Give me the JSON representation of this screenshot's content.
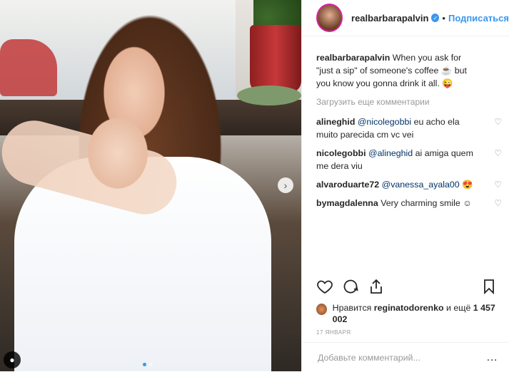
{
  "post": {
    "author": "realbarbarapalvin",
    "verified_icon": "verified-badge-icon",
    "separator": "•",
    "follow_label": "Подписаться",
    "caption": {
      "user": "realbarbarapalvin",
      "text": " When you ask for \"just a sip\" of someone's coffee ☕ but you know you gonna drink it all. 😜"
    },
    "load_more_label": "Загрузить еще комментарии",
    "comments": [
      {
        "user": "alineghid",
        "mention": "@nicolegobbi",
        "text": " eu acho ela muito parecida cm vc vei"
      },
      {
        "user": "nicolegobbi",
        "mention": "@alineghid",
        "text": " ai amiga quem me dera viu"
      },
      {
        "user": "alvaroduarte72",
        "mention": "@vanessa_ayala00",
        "text": " 😍"
      },
      {
        "user": "bymagdalenna",
        "mention": "",
        "text": " Very charming smile ☺"
      }
    ],
    "likes": {
      "prefix": "Нравится ",
      "liker": "reginatodorenko",
      "middle": " и ещё ",
      "count": "1 457 002"
    },
    "date": "17 ЯНВАРЯ",
    "add_comment_placeholder": "Добавьте комментарий...",
    "more_label": "…",
    "carousel": {
      "current_index": 1,
      "total": 2
    }
  },
  "icons": {
    "like": "heart-icon",
    "comment": "comment-icon",
    "share": "share-icon",
    "save": "bookmark-icon",
    "next": "chevron-right-icon",
    "tag": "user-tag-icon"
  },
  "colors": {
    "accent": "#3897f0",
    "text": "#262626",
    "muted": "#999999"
  }
}
